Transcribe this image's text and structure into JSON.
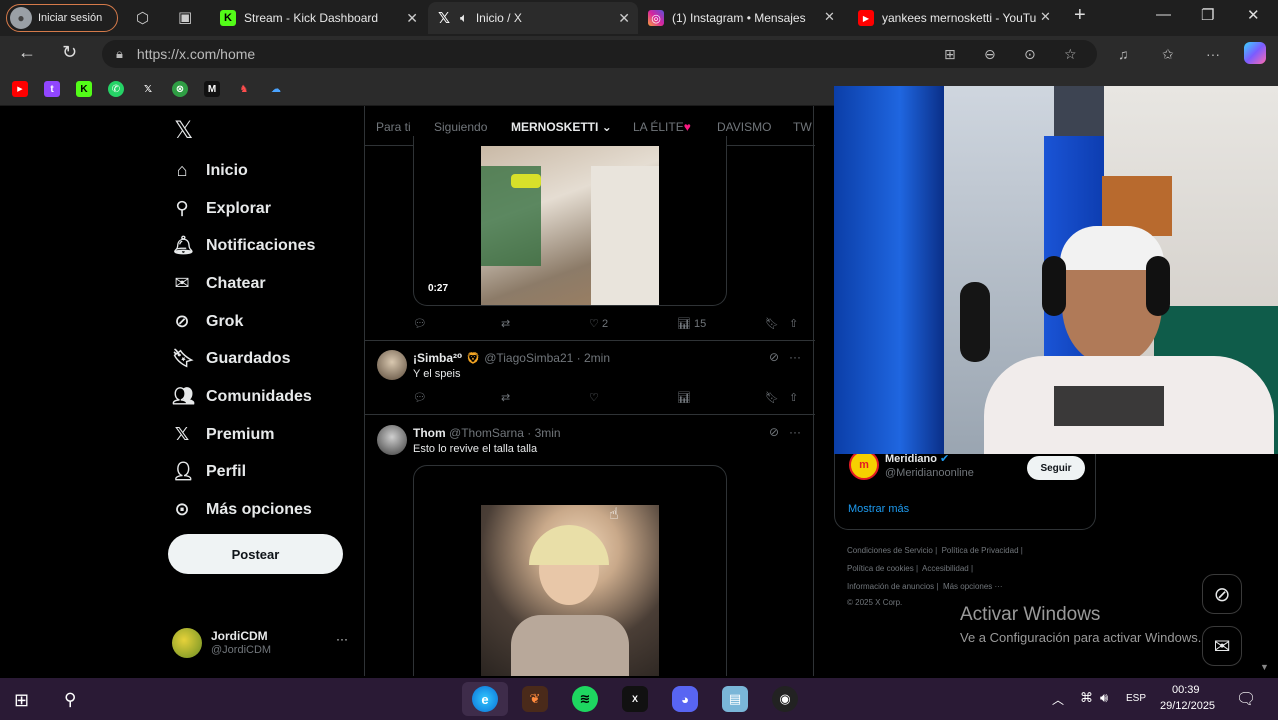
{
  "browser": {
    "profile_label": "Iniciar sesión",
    "tabs": [
      {
        "title": "Stream - Kick Dashboard",
        "icon": "kick-icon"
      },
      {
        "title": "Inicio / X",
        "icon": "x-icon"
      },
      {
        "title": "(1) Instagram • Mensajes",
        "icon": "instagram-icon"
      },
      {
        "title": "yankees mernosketti - YouTu",
        "icon": "youtube-icon"
      }
    ],
    "url": "https://x.com/home",
    "colors": {
      "chrome": "#1f1f1f",
      "toolbar": "#2b2b2b"
    }
  },
  "sidebar": {
    "items": [
      {
        "label": "Inicio",
        "icon": "home-icon"
      },
      {
        "label": "Explorar",
        "icon": "search-icon"
      },
      {
        "label": "Notificaciones",
        "icon": "bell-icon"
      },
      {
        "label": "Chatear",
        "icon": "mail-icon"
      },
      {
        "label": "Grok",
        "icon": "grok-icon"
      },
      {
        "label": "Guardados",
        "icon": "bookmark-icon"
      },
      {
        "label": "Comunidades",
        "icon": "people-icon"
      },
      {
        "label": "Premium",
        "icon": "x-icon"
      },
      {
        "label": "Perfil",
        "icon": "person-icon"
      },
      {
        "label": "Más opciones",
        "icon": "more-circle-icon"
      }
    ],
    "post_button": "Postear",
    "account": {
      "name": "JordiCDM",
      "handle": "@JordiCDM",
      "menu": "···"
    }
  },
  "feed": {
    "tabs": [
      "Para ti",
      "Siguiendo",
      "MERNOSKETTI",
      "LA ÉLITE",
      "DAVISMO",
      "TW"
    ],
    "tweets": [
      {
        "video_time": "0:27",
        "likes": "2",
        "views": "15"
      },
      {
        "name": "¡Simba²⁰",
        "handle": "@TiagoSimba21",
        "time": "· 2min",
        "text": "Y el speis"
      },
      {
        "name": "Thom",
        "handle": "@ThomSarna",
        "time": "· 3min",
        "text": "Esto lo revive el talla talla"
      }
    ]
  },
  "right": {
    "suggestion": {
      "name": "Meridiano",
      "handle": "@Meridianoonline",
      "follow": "Seguir"
    },
    "show_more": "Mostrar más",
    "footer": [
      "Condiciones de Servicio",
      "Política de Privacidad",
      "Política de cookies",
      "Accesibilidad",
      "Información de anuncios",
      "Más opciones ···",
      "© 2025 X Corp."
    ],
    "watermark_title": "Activar Windows",
    "watermark_sub": "Ve a Configuración para activar Windows."
  },
  "taskbar": {
    "lang": "ESP",
    "time": "00:39",
    "date": "29/12/2025"
  }
}
